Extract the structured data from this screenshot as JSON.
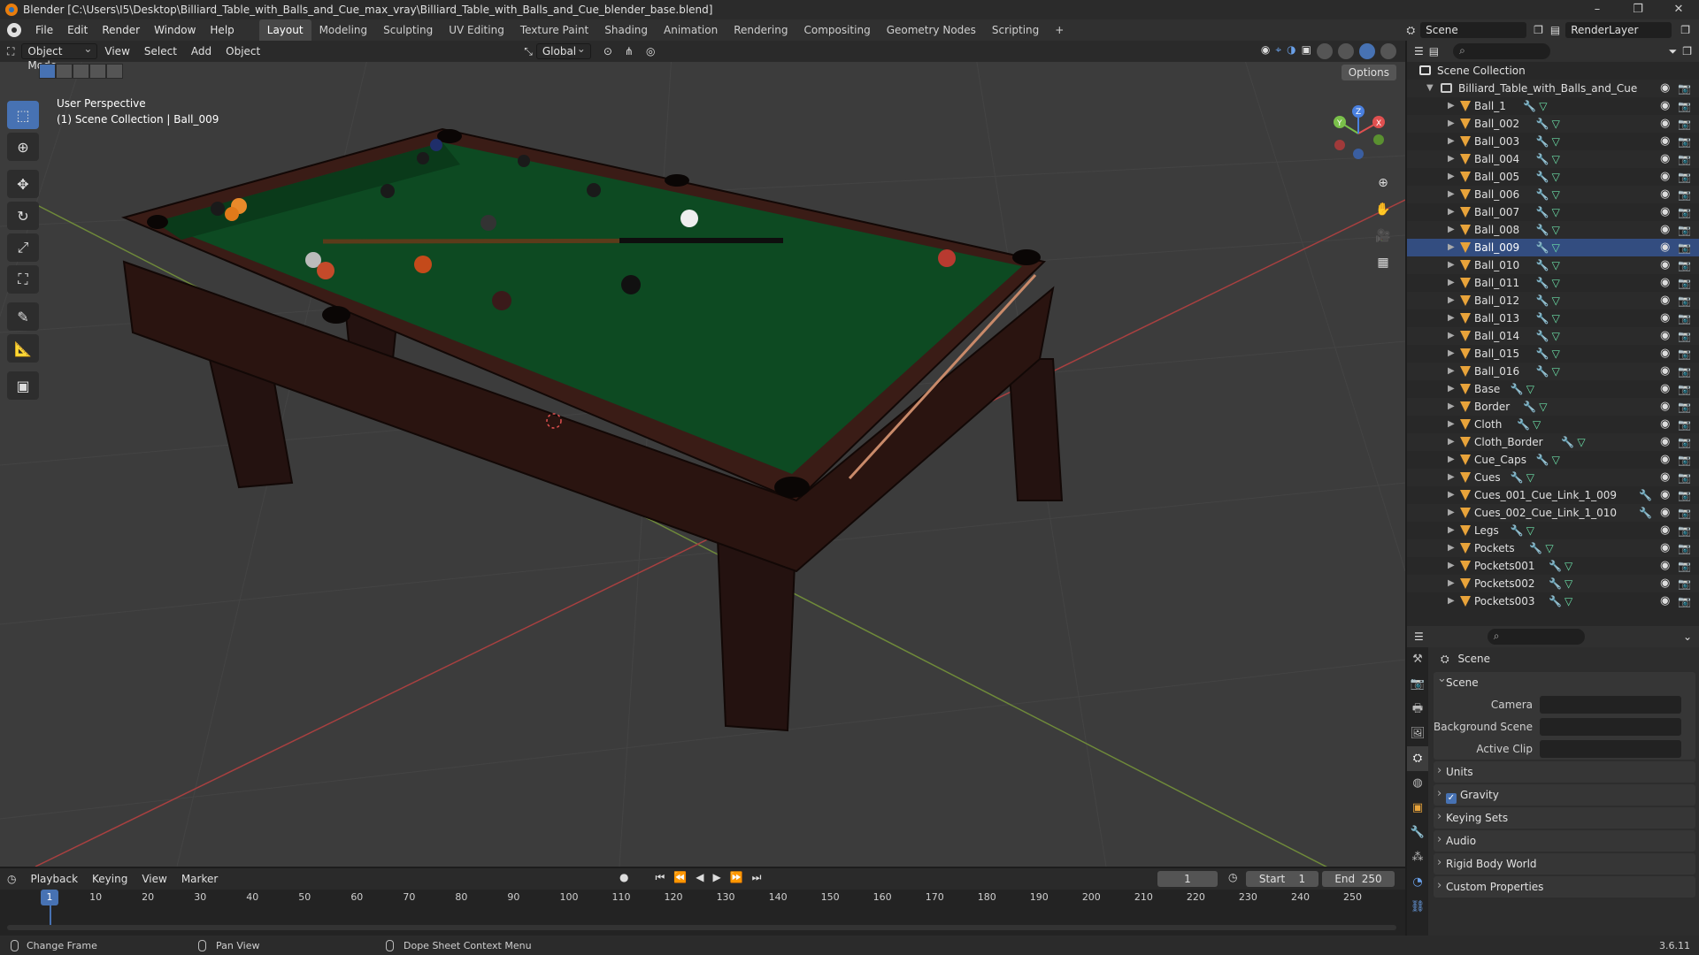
{
  "window": {
    "title": "Blender [C:\\Users\\I5\\Desktop\\Billiard_Table_with_Balls_and_Cue_max_vray\\Billiard_Table_with_Balls_and_Cue_blender_base.blend]",
    "minimize": "–",
    "maximize": "❐",
    "close": "✕"
  },
  "menubar": {
    "menus": [
      "File",
      "Edit",
      "Render",
      "Window",
      "Help"
    ],
    "workspaces": [
      "Layout",
      "Modeling",
      "Sculpting",
      "UV Editing",
      "Texture Paint",
      "Shading",
      "Animation",
      "Rendering",
      "Compositing",
      "Geometry Nodes",
      "Scripting"
    ],
    "active_workspace": "Layout",
    "add_workspace": "+",
    "scene_name": "Scene",
    "view_layer": "RenderLayer"
  },
  "viewport": {
    "mode": "Object Mode",
    "menus": [
      "View",
      "Select",
      "Add",
      "Object"
    ],
    "transform_orientation": "Global",
    "options_label": "Options",
    "info_line1": "User Perspective",
    "info_line2": "(1) Scene Collection | Ball_009",
    "gizmo_axes": {
      "x": "X",
      "y": "Y",
      "z": "Z"
    }
  },
  "outliner": {
    "root": "Scene Collection",
    "collection": "Billiard_Table_with_Balls_and_Cue",
    "selected": "Ball_009",
    "objects": [
      {
        "name": "Ball_1",
        "mods": true,
        "mesh": true
      },
      {
        "name": "Ball_002",
        "mods": true,
        "mesh": true
      },
      {
        "name": "Ball_003",
        "mods": true,
        "mesh": true
      },
      {
        "name": "Ball_004",
        "mods": true,
        "mesh": true
      },
      {
        "name": "Ball_005",
        "mods": true,
        "mesh": true
      },
      {
        "name": "Ball_006",
        "mods": true,
        "mesh": true
      },
      {
        "name": "Ball_007",
        "mods": true,
        "mesh": true
      },
      {
        "name": "Ball_008",
        "mods": true,
        "mesh": true
      },
      {
        "name": "Ball_009",
        "mods": true,
        "mesh": true
      },
      {
        "name": "Ball_010",
        "mods": true,
        "mesh": true
      },
      {
        "name": "Ball_011",
        "mods": true,
        "mesh": true
      },
      {
        "name": "Ball_012",
        "mods": true,
        "mesh": true
      },
      {
        "name": "Ball_013",
        "mods": true,
        "mesh": true
      },
      {
        "name": "Ball_014",
        "mods": true,
        "mesh": true
      },
      {
        "name": "Ball_015",
        "mods": true,
        "mesh": true
      },
      {
        "name": "Ball_016",
        "mods": true,
        "mesh": true
      },
      {
        "name": "Base",
        "mods": true,
        "mesh": true
      },
      {
        "name": "Border",
        "mods": true,
        "mesh": true
      },
      {
        "name": "Cloth",
        "mods": true,
        "mesh": true
      },
      {
        "name": "Cloth_Border",
        "mods": true,
        "mesh": true
      },
      {
        "name": "Cue_Caps",
        "mods": true,
        "mesh": true
      },
      {
        "name": "Cues",
        "mods": true,
        "mesh": true
      },
      {
        "name": "Cues_001_Cue_Link_1_009",
        "mods": true,
        "mesh": false
      },
      {
        "name": "Cues_002_Cue_Link_1_010",
        "mods": true,
        "mesh": false
      },
      {
        "name": "Legs",
        "mods": true,
        "mesh": true
      },
      {
        "name": "Pockets",
        "mods": true,
        "mesh": true
      },
      {
        "name": "Pockets001",
        "mods": true,
        "mesh": true
      },
      {
        "name": "Pockets002",
        "mods": true,
        "mesh": true
      },
      {
        "name": "Pockets003",
        "mods": true,
        "mesh": true
      }
    ]
  },
  "properties": {
    "title": "Scene",
    "scene_panel": "Scene",
    "fields": [
      {
        "label": "Camera"
      },
      {
        "label": "Background Scene"
      },
      {
        "label": "Active Clip"
      }
    ],
    "panels": [
      "Units",
      "Gravity",
      "Keying Sets",
      "Audio",
      "Rigid Body World",
      "Custom Properties"
    ],
    "gravity_checked": true
  },
  "timeline": {
    "menus": [
      "Playback",
      "Keying",
      "View",
      "Marker"
    ],
    "current_frame": "1",
    "start_label": "Start",
    "start": "1",
    "end_label": "End",
    "end": "250",
    "ticks": [
      "10",
      "20",
      "30",
      "40",
      "50",
      "60",
      "70",
      "80",
      "90",
      "100",
      "110",
      "120",
      "130",
      "140",
      "150",
      "160",
      "170",
      "180",
      "190",
      "200",
      "210",
      "220",
      "230",
      "240",
      "250"
    ]
  },
  "statusbar": {
    "hint1": "Change Frame",
    "hint2": "Pan View",
    "hint3": "Dope Sheet Context Menu",
    "version": "3.6.11"
  },
  "colors": {
    "accent": "#4772b3",
    "cloth": "#0d4a22",
    "wood": "#2a1410",
    "object_icon": "#e8a33a"
  }
}
